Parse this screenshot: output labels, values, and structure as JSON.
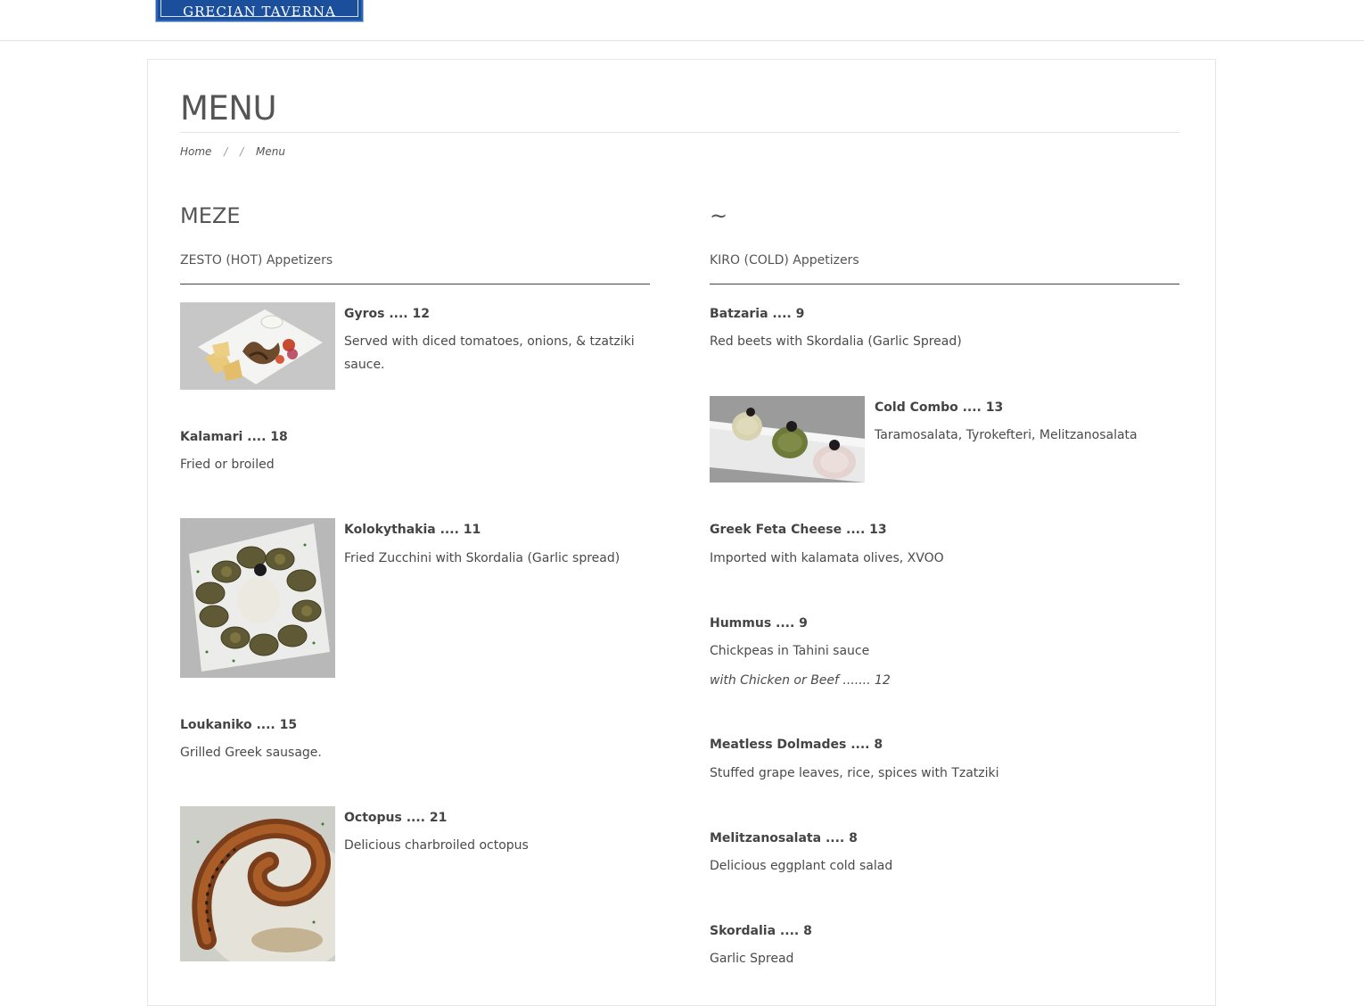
{
  "header": {
    "logo_text": "GRECIAN TAVERNA"
  },
  "page": {
    "title": "MENU",
    "breadcrumb": [
      "Home",
      "/",
      "/",
      "Menu"
    ]
  },
  "left_column": {
    "heading": "MEZE",
    "subheading": "ZESTO (HOT) Appetizers",
    "items": [
      {
        "name": "Gyros .... 12",
        "desc": "Served with diced tomatoes, onions, & tzatziki sauce.",
        "photo": "gyros-plate-photo"
      },
      {
        "name": "Kalamari .... 18",
        "desc": "Fried or broiled"
      },
      {
        "name": "Kolokythakia .... 11",
        "desc": "Fried Zucchini with Skordalia (Garlic spread)",
        "photo": "zucchini-plate-photo"
      },
      {
        "name": "Loukaniko .... 15",
        "desc": "Grilled Greek sausage."
      },
      {
        "name": "Octopus .... 21",
        "desc": "Delicious charbroiled octopus",
        "photo": "octopus-photo"
      }
    ]
  },
  "right_column": {
    "heading": "~",
    "subheading": "KIRO (COLD) Appetizers",
    "items": [
      {
        "name": "Batzaria .... 9",
        "desc": "Red beets with Skordalia (Garlic Spread)"
      },
      {
        "name": "Cold Combo .... 13",
        "desc": "Taramosalata, Tyrokefteri, Melitzanosalata",
        "photo": "cold-combo-photo"
      },
      {
        "name": "Greek Feta Cheese .... 13",
        "desc": "Imported with kalamata olives, XVOO"
      },
      {
        "name": "Hummus .... 9",
        "desc": "Chickpeas in Tahini sauce",
        "extra": "with Chicken or Beef ....... 12"
      },
      {
        "name": "Meatless Dolmades .... 8",
        "desc": "Stuffed grape leaves, rice, spices with Tzatziki"
      },
      {
        "name": "Melitzanosalata .... 8",
        "desc": "Delicious eggplant cold salad"
      },
      {
        "name": "Skordalia .... 8",
        "desc": "Garlic Spread"
      }
    ]
  }
}
